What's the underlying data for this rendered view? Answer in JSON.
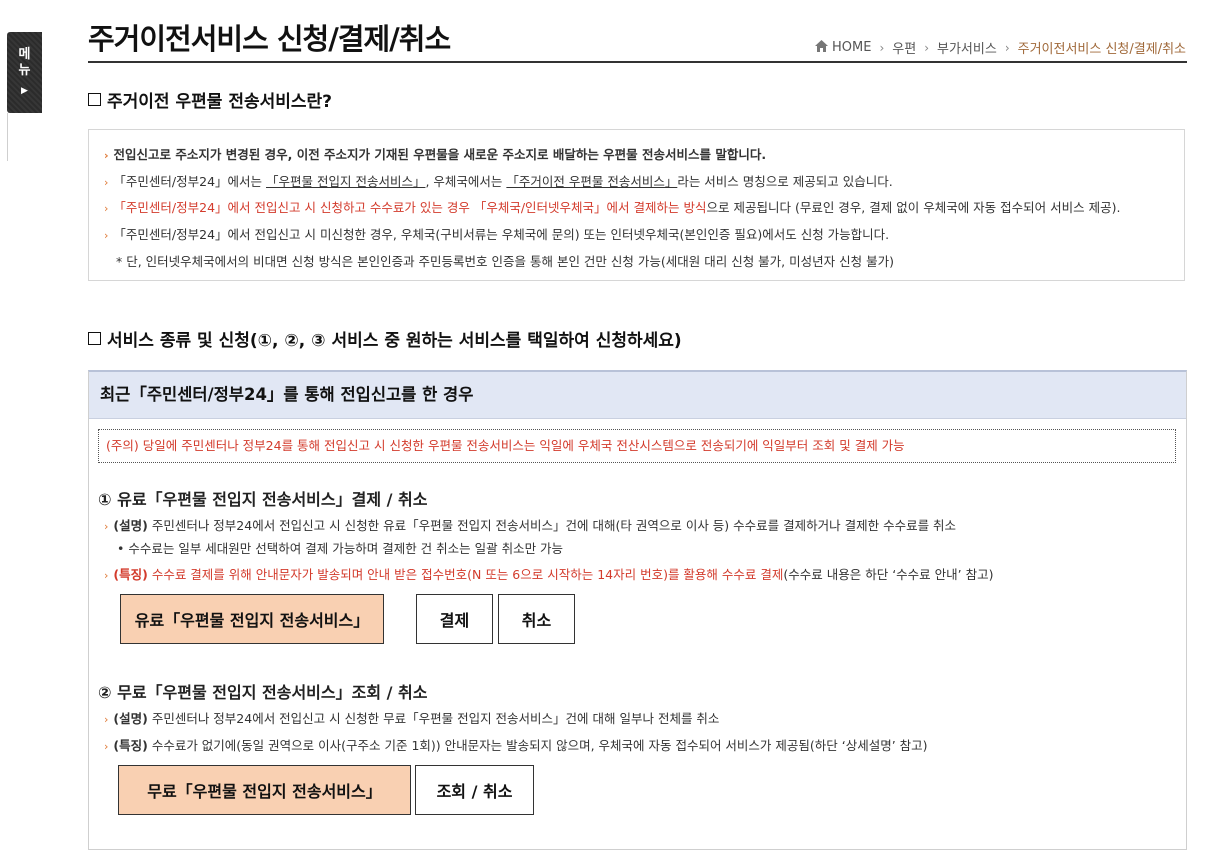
{
  "side_menu": {
    "label_line1": "메",
    "label_line2": "뉴",
    "arrow": "▶"
  },
  "header": {
    "title": "주거이전서비스 신청/결제/취소",
    "breadcrumb": [
      "HOME",
      "우편",
      "부가서비스",
      "주거이전서비스 신청/결제/취소"
    ]
  },
  "intro": {
    "heading": "주거이전 우편물 전송서비스란?",
    "line1": "전입신고로 주소지가 변경된 경우, 이전 주소지가 기재된 우편물을 새로운 주소지로 배달하는 우편물 전송서비스를 말합니다.",
    "line2_a": "「주민센터/정부24」에서는 ",
    "line2_b": "「우편물 전입지 전송서비스」",
    "line2_c": ", 우체국에서는 ",
    "line2_d": "「주거이전 우편물 전송서비스」",
    "line2_e": "라는 서비스 명칭으로 제공되고 있습니다.",
    "line3_red": "「주민센터/정부24」에서 전입신고 시 신청하고 수수료가 있는 경우 「우체국/인터넷우체국」에서 결제하는 방식",
    "line3_rest": "으로 제공됩니다 (무료인 경우, 결제 없이 우체국에 자동 접수되어 서비스 제공).",
    "line4": "「주민센터/정부24」에서 전입신고 시 미신청한 경우, 우체국(구비서류는 우체국에 문의) 또는 인터넷우체국(본인인증 필요)에서도 신청 가능합니다.",
    "note": "* 단, 인터넷우체국에서의 비대면 신청 방식은 본인인증과 주민등록번호 인증을 통해 본인 건만 신청 가능(세대원 대리 신청 불가, 미성년자 신청 불가)"
  },
  "services": {
    "heading": "서비스 종류 및 신청(①, ②, ③ 서비스 중 원하는 서비스를 택일하여 신청하세요)",
    "panel_title": "최근「주민센터/정부24」를 통해 전입신고를 한 경우",
    "notice": "(주의) 당일에 주민센터나 정부24를 통해 전입신고 시 신청한 우편물 전송서비스는 익일에 우체국 전산시스템으로 전송되기에 익일부터 조회 및 결제 가능",
    "paid": {
      "title": "① 유료「우편물 전입지 전송서비스」결제 / 취소",
      "desc_label": "(설명)",
      "desc": " 주민센터나 정부24에서 전입신고 시 신청한 유료「우편물 전입지 전송서비스」건에 대해(타 권역으로 이사 등) 수수료를 결제하거나 결제한 수수료를 취소",
      "sub": "• 수수료는 일부 세대원만 선택하여 결제 가능하며 결제한 건 취소는 일괄 취소만 가능",
      "feature_label": "(특징)",
      "feature_red": " 수수료 결제를 위해 안내문자가 발송되며 안내 받은 접수번호(N 또는 6으로 시작하는 14자리 번호)를 활용해 수수료 결제",
      "feature_rest": "(수수료 내용은 하단 ‘수수료 안내’ 참고)",
      "btn_main": "유료「우편물 전입지 전송서비스」",
      "btn_pay": "결제",
      "btn_cancel": "취소"
    },
    "free": {
      "title": "② 무료「우편물 전입지 전송서비스」조회 / 취소",
      "desc_label": "(설명)",
      "desc": " 주민센터나 정부24에서 전입신고 시 신청한 무료「우편물 전입지 전송서비스」건에 대해 일부나 전체를 취소",
      "feature_label": "(특징)",
      "feature": " 수수료가 없기에(동일 권역으로 이사(구주소 기준 1회)) 안내문자는 발송되지 않으며, 우체국에 자동 접수되어 서비스가 제공됨(하단 ‘상세설명’ 참고)",
      "btn_main": "무료「우편물 전입지 전송서비스」",
      "btn_lookup": "조회 / 취소"
    }
  },
  "colors": {
    "accent": "#e07b39",
    "red": "#d33b2c",
    "panel_head": "#e1e7f4",
    "btn_main": "#f9d0b2",
    "breadcrumb_current": "#a0693a"
  }
}
